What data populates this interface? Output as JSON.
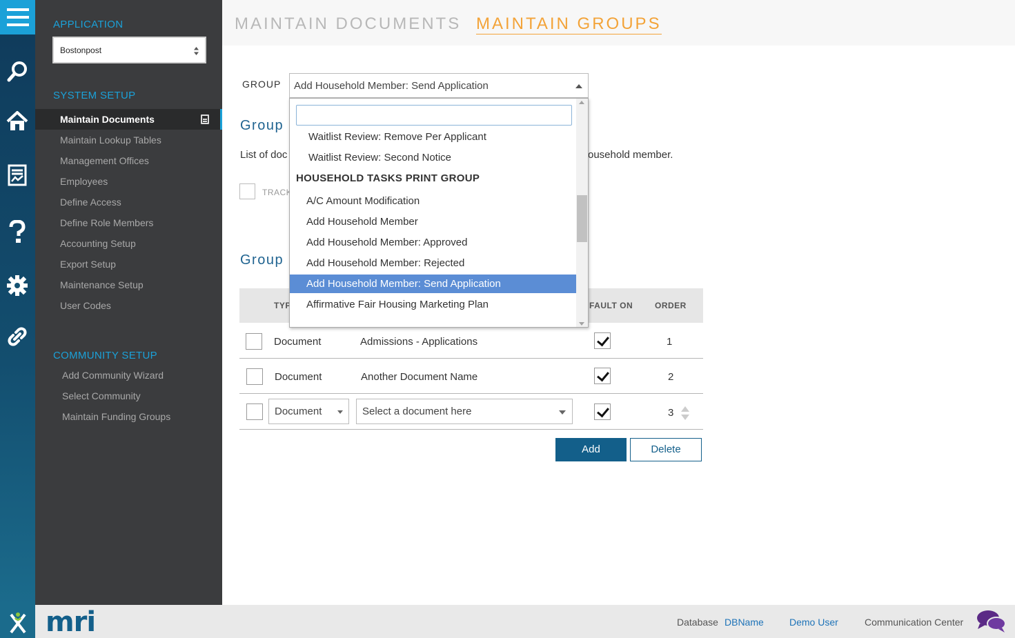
{
  "tabs": {
    "documents": "MAINTAIN DOCUMENTS",
    "groups": "MAINTAIN GROUPS"
  },
  "sidebar": {
    "application_title": "APPLICATION",
    "application_value": "Bostonpost",
    "system_setup_title": "SYSTEM SETUP",
    "system_items": [
      "Maintain Documents",
      "Maintain Lookup Tables",
      "Management Offices",
      "Employees",
      "Define Access",
      "Define Role Members",
      "Accounting Setup",
      "Export Setup",
      "Maintenance Setup",
      "User Codes"
    ],
    "community_setup_title": "COMMUNITY SETUP",
    "community_items": [
      "Add Community Wizard",
      "Select Community",
      "Maintain Funding Groups"
    ]
  },
  "main": {
    "group_label": "GROUP",
    "group_selected": "Add Household Member: Send Application",
    "heading_1": "Group",
    "heading_2": "Group",
    "desc_left": "List of doc",
    "desc_right": "ousehold member.",
    "track_label": "TRACK"
  },
  "dropdown": {
    "search_value": "",
    "top_items": [
      "Waitlist Review: Remove Per Applicant",
      "Waitlist Review: Second Notice"
    ],
    "group_header": "HOUSEHOLD TASKS PRINT GROUP",
    "options": [
      "A/C Amount Modification",
      "Add Household Member",
      "Add Household Member: Approved",
      "Add Household Member: Rejected",
      "Add Household Member: Send Application",
      "Affirmative Fair Housing Marketing Plan"
    ],
    "selected_index": 4
  },
  "table": {
    "headers": {
      "type": "TYP",
      "default_on": "FAULT ON",
      "order": "ORDER"
    },
    "rows": [
      {
        "type": "Document",
        "name": "Admissions - Applications",
        "default_on": true,
        "order": "1"
      },
      {
        "type": "Document",
        "name": "Another Document Name",
        "default_on": true,
        "order": "2"
      },
      {
        "type": "Document",
        "name": "Select a document here",
        "default_on": true,
        "order": "3"
      }
    ]
  },
  "buttons": {
    "add": "Add",
    "delete": "Delete"
  },
  "footer": {
    "logo_text": "mri",
    "database_label": "Database",
    "database_name": "DBName",
    "user": "Demo User",
    "communication_center": "Communication Center"
  },
  "colors": {
    "accent_blue": "#1ba1d8",
    "active_tab_orange": "#f3a338",
    "primary_button": "#135f8a",
    "selection_blue": "#5b8dd5"
  }
}
